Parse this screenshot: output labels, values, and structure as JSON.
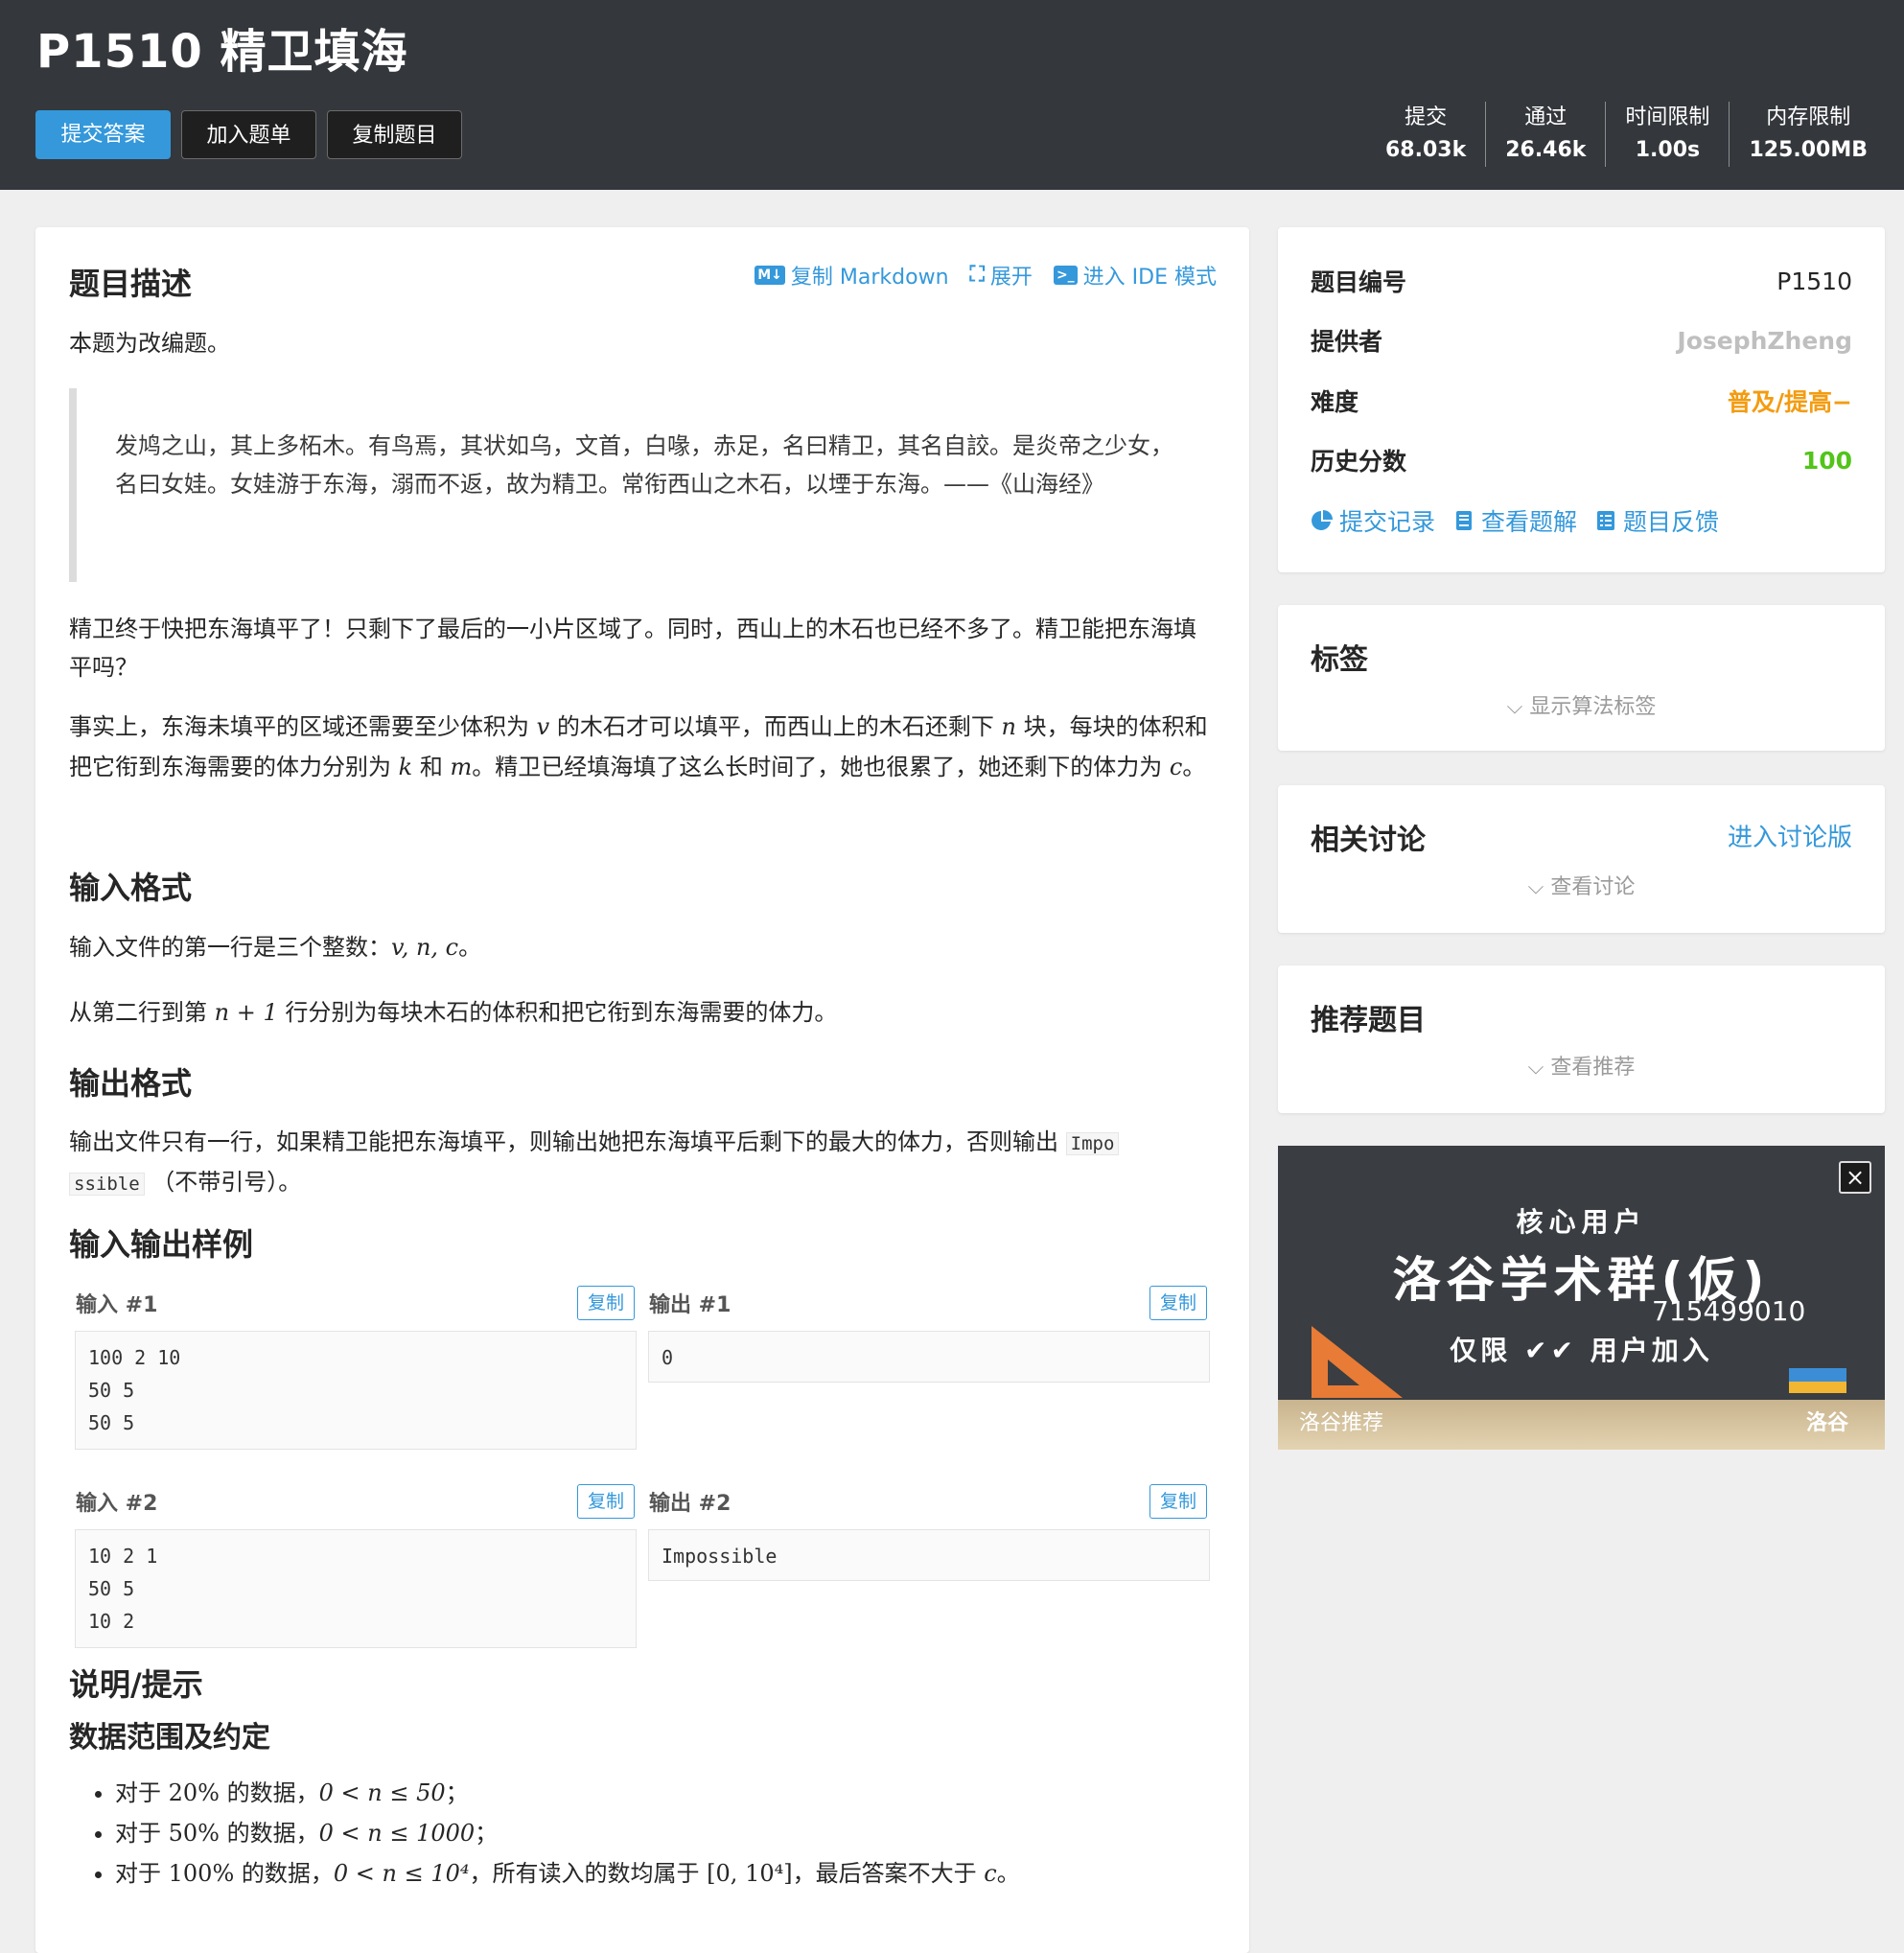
{
  "header": {
    "title": "P1510 精卫填海",
    "buttons": {
      "submit": "提交答案",
      "add_list": "加入题单",
      "copy": "复制题目"
    },
    "stats": [
      {
        "label": "提交",
        "value": "68.03k"
      },
      {
        "label": "通过",
        "value": "26.46k"
      },
      {
        "label": "时间限制",
        "value": "1.00s"
      },
      {
        "label": "内存限制",
        "value": "125.00MB"
      }
    ]
  },
  "main": {
    "desc_title": "题目描述",
    "toolbar": {
      "copy_md": "复制 Markdown",
      "expand": "展开",
      "ide": "进入 IDE 模式"
    },
    "intro": "本题为改编题。",
    "quote": "发鸠之山，其上多柘木。有鸟焉，其状如乌，文首，白喙，赤足，名曰精卫，其名自詨。是炎帝之少女，名曰女娃。女娃游于东海，溺而不返，故为精卫。常衔西山之木石，以堙于东海。——《山海经》",
    "para1": "精卫终于快把东海填平了！只剩下了最后的一小片区域了。同时，西山上的木石也已经不多了。精卫能把东海填平吗？",
    "para2": {
      "t1": "事实上，东海未填平的区域还需要至少体积为 ",
      "v": "v",
      "t2": " 的木石才可以填平，而西山上的木石还剩下 ",
      "n": "n",
      "t3": " 块，每块的体积和把它衔到东海需要的体力分别为 ",
      "k": "k",
      "t4": " 和 ",
      "m": "m",
      "t5": "。精卫已经填海填了这么长时间了，她也很累了，她还剩下的体力为 ",
      "c": "c",
      "t6": "。"
    },
    "input_title": "输入格式",
    "input1": {
      "t1": "输入文件的第一行是三个整数：",
      "math": "v, n, c",
      "t2": "。"
    },
    "input2": {
      "t1": "从第二行到第 ",
      "math": "n + 1",
      "t2": " 行分别为每块木石的体积和把它衔到东海需要的体力。"
    },
    "output_title": "输出格式",
    "output": {
      "t1": "输出文件只有一行，如果精卫能把东海填平，则输出她把东海填平后剩下的最大的体力，否则输出 ",
      "code1": "Impo",
      "code2": "ssible",
      "t2": " （不带引号）。"
    },
    "samples_title": "输入输出样例",
    "copy_label": "复制",
    "samples": [
      {
        "in_label": "输入 #1",
        "out_label": "输出 #1",
        "input": "100 2 10\n50 5\n50 5",
        "output": "0"
      },
      {
        "in_label": "输入 #2",
        "out_label": "输出 #2",
        "input": "10 2 1\n50 5\n10 2",
        "output": "Impossible"
      }
    ],
    "hint_title": "说明/提示",
    "range_title": "数据范围及约定",
    "bullets": [
      {
        "t1": "对于 ",
        "m1": "20%",
        "t2": " 的数据，",
        "m2": "0 < n ≤ 50",
        "t3": "；"
      },
      {
        "t1": "对于 ",
        "m1": "50%",
        "t2": " 的数据，",
        "m2": "0 < n ≤ 1000",
        "t3": "；"
      },
      {
        "t1": "对于 ",
        "m1": "100%",
        "t2": " 的数据，",
        "m2": "0 < n ≤ 10⁴",
        "t3": "，所有读入的数均属于 ",
        "m3": "[0, 10⁴]",
        "t4": "，最后答案不大于 ",
        "m4": "c",
        "t5": "。"
      }
    ]
  },
  "info": {
    "rows": [
      {
        "key": "题目编号",
        "value": "P1510",
        "color": "#262626"
      },
      {
        "key": "提供者",
        "value": "JosephZheng",
        "color": "#bfbfbf"
      },
      {
        "key": "难度",
        "value": "普及/提高−",
        "color": "#f39c11"
      },
      {
        "key": "历史分数",
        "value": "100",
        "color": "#52c41a"
      }
    ],
    "links": {
      "records": "提交记录",
      "solutions": "查看题解",
      "feedback": "题目反馈"
    }
  },
  "tags": {
    "title": "标签",
    "toggle": "显示算法标签"
  },
  "discuss": {
    "title": "相关讨论",
    "link": "进入讨论版",
    "toggle": "查看讨论"
  },
  "recommend": {
    "title": "推荐题目",
    "toggle": "查看推荐"
  },
  "ad": {
    "top": "核心用户",
    "main": "洛谷学术群(仮)",
    "number": "715499010",
    "sub": "仅限 ✔✔ 用户加入",
    "badge": "洛谷推荐",
    "brand": "洛谷",
    "close": "×"
  },
  "colors": {
    "accent": "#3498db",
    "header_bg": "#34373c"
  }
}
